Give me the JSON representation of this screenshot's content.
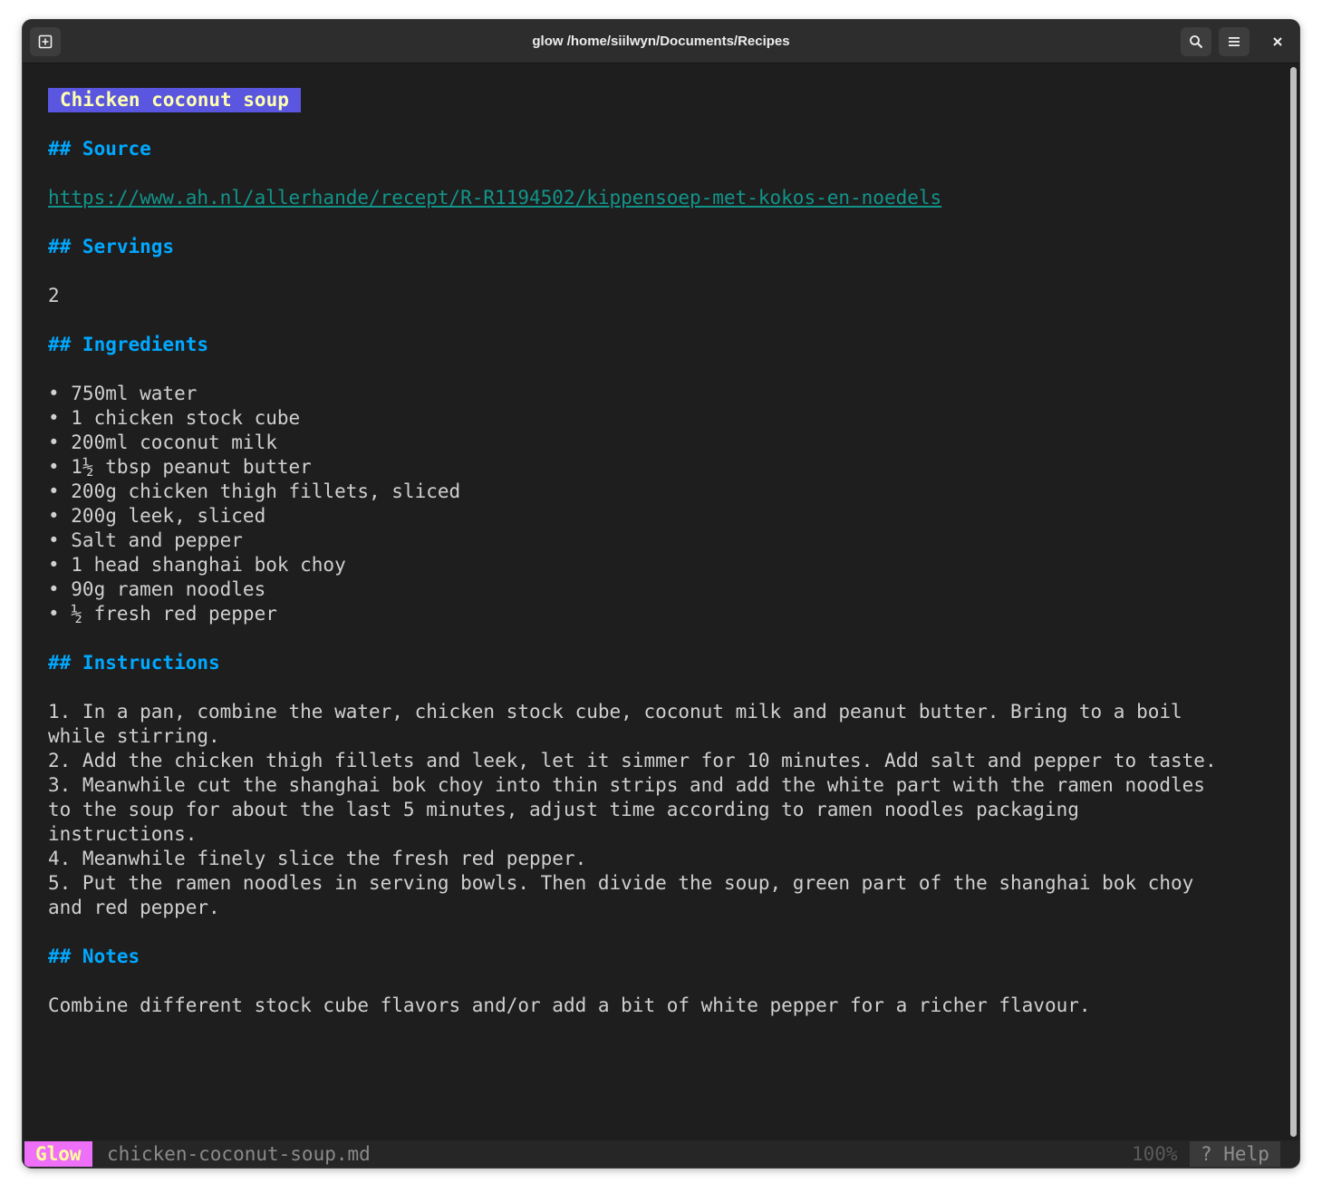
{
  "window": {
    "title": "glow /home/siilwyn/Documents/Recipes"
  },
  "doc": {
    "title": "Chicken coconut soup",
    "source_heading": "## Source",
    "source_url": "https://www.ah.nl/allerhande/recept/R-R1194502/kippensoep-met-kokos-en-noedels",
    "servings_heading": "## Servings",
    "servings_value": "2",
    "ingredients_heading": "## Ingredients",
    "ingredients": [
      "• 750ml water",
      "• 1 chicken stock cube",
      "• 200ml coconut milk",
      "• 1½ tbsp peanut butter",
      "• 200g chicken thigh fillets, sliced",
      "• 200g leek, sliced",
      "• Salt and pepper",
      "• 1 head shanghai bok choy",
      "• 90g ramen noodles",
      "• ½ fresh red pepper"
    ],
    "instructions_heading": "## Instructions",
    "instructions": [
      "1. In a pan, combine the water, chicken stock cube, coconut milk and peanut butter. Bring to a boil",
      "while stirring.",
      "2. Add the chicken thigh fillets and leek, let it simmer for 10 minutes. Add salt and pepper to taste.",
      "3. Meanwhile cut the shanghai bok choy into thin strips and add the white part with the ramen noodles",
      "to the soup for about the last 5 minutes, adjust time according to ramen noodles packaging",
      "instructions.",
      "4. Meanwhile finely slice the fresh red pepper.",
      "5. Put the ramen noodles in serving bowls. Then divide the soup, green part of the shanghai bok choy",
      "and red pepper."
    ],
    "notes_heading": "## Notes",
    "notes": "Combine different stock cube flavors and/or add a bit of white pepper for a richer flavour."
  },
  "status": {
    "app_label": "Glow",
    "filename": "chicken-coconut-soup.md",
    "percent": "100%",
    "help": "? Help"
  },
  "icons": {
    "new_tab": "new-tab-icon",
    "search": "search-icon",
    "menu": "menu-icon",
    "close": "close-icon"
  },
  "colors": {
    "title_badge_bg": "#5a56e0",
    "title_badge_fg": "#ffffb0",
    "heading": "#00a8ff",
    "link": "#12948a",
    "glow_badge_bg": "#ee6ff8",
    "glow_badge_fg": "#fffd9e"
  }
}
